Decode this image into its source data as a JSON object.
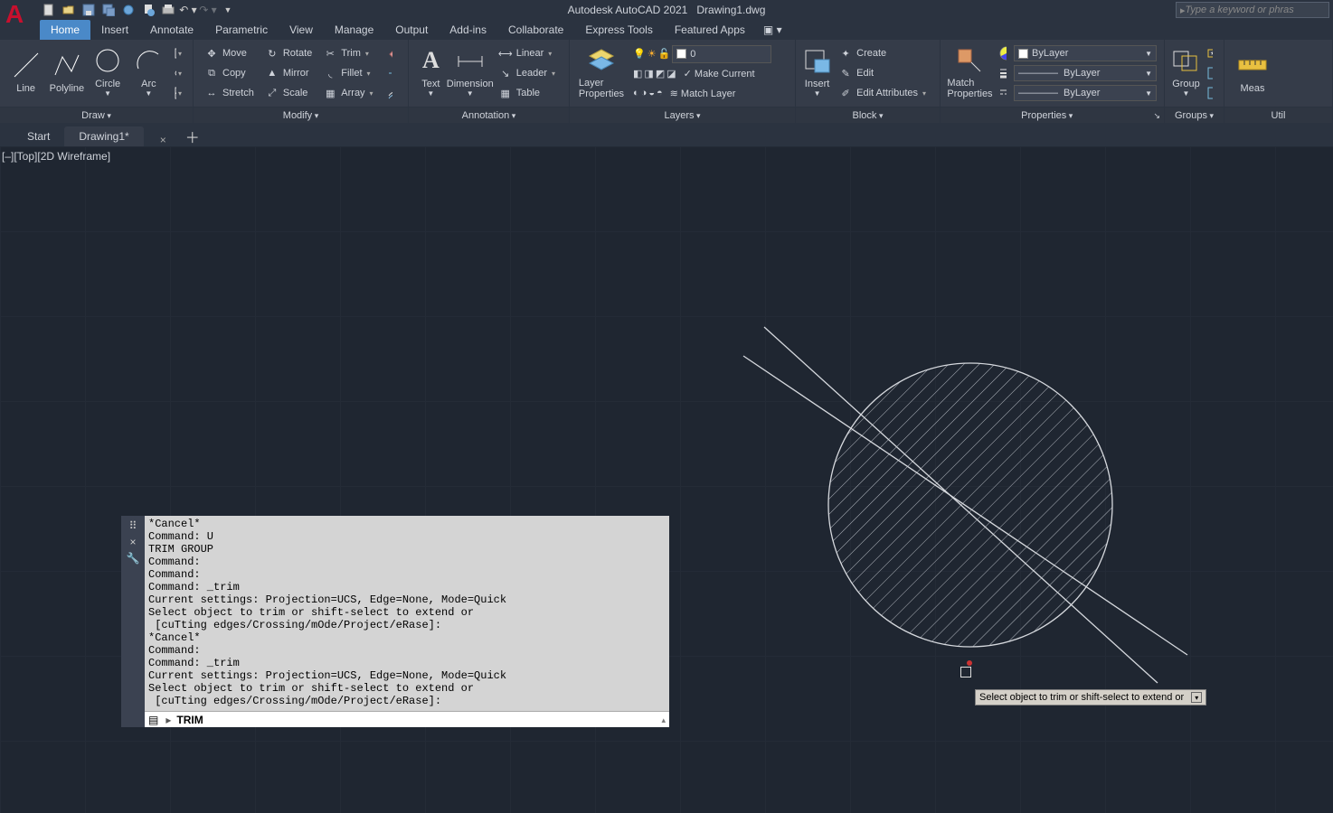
{
  "title": {
    "app": "Autodesk AutoCAD 2021",
    "file": "Drawing1.dwg"
  },
  "search_placeholder": "Type a keyword or phras",
  "tabs": [
    "Home",
    "Insert",
    "Annotate",
    "Parametric",
    "View",
    "Manage",
    "Output",
    "Add-ins",
    "Collaborate",
    "Express Tools",
    "Featured Apps"
  ],
  "active_tab": "Home",
  "ribbon": {
    "draw": {
      "title": "Draw",
      "line": "Line",
      "polyline": "Polyline",
      "circle": "Circle",
      "arc": "Arc"
    },
    "modify": {
      "title": "Modify",
      "move": "Move",
      "rotate": "Rotate",
      "trim": "Trim",
      "copy": "Copy",
      "mirror": "Mirror",
      "fillet": "Fillet",
      "stretch": "Stretch",
      "scale": "Scale",
      "array": "Array"
    },
    "annotation": {
      "title": "Annotation",
      "text": "Text",
      "dimension": "Dimension",
      "linear": "Linear",
      "leader": "Leader",
      "table": "Table"
    },
    "layers": {
      "title": "Layers",
      "layer_props": "Layer\nProperties",
      "current": "0",
      "make_current": "Make Current",
      "match_layer": "Match Layer"
    },
    "block": {
      "title": "Block",
      "insert": "Insert",
      "create": "Create",
      "edit": "Edit",
      "edit_attr": "Edit Attributes"
    },
    "properties": {
      "title": "Properties",
      "match": "Match\nProperties",
      "layer": "ByLayer",
      "ltype": "ByLayer",
      "lweight": "ByLayer"
    },
    "groups": {
      "title": "Groups",
      "group": "Group"
    },
    "utilities": {
      "title": "Util",
      "meas": "Meas"
    }
  },
  "filetabs": {
    "start": "Start",
    "drawing": "Drawing1*"
  },
  "viewport_label": "[–][Top][2D Wireframe]",
  "tooltip": "Select object to trim or shift-select to extend or",
  "cmd_log": "*Cancel*\nCommand: U\nTRIM GROUP\nCommand:\nCommand:\nCommand: _trim\nCurrent settings: Projection=UCS, Edge=None, Mode=Quick\nSelect object to trim or shift-select to extend or\n [cuTting edges/Crossing/mOde/Project/eRase]:\n*Cancel*\nCommand:\nCommand: _trim\nCurrent settings: Projection=UCS, Edge=None, Mode=Quick\nSelect object to trim or shift-select to extend or\n [cuTting edges/Crossing/mOde/Project/eRase]:",
  "cmd_current": "TRIM"
}
